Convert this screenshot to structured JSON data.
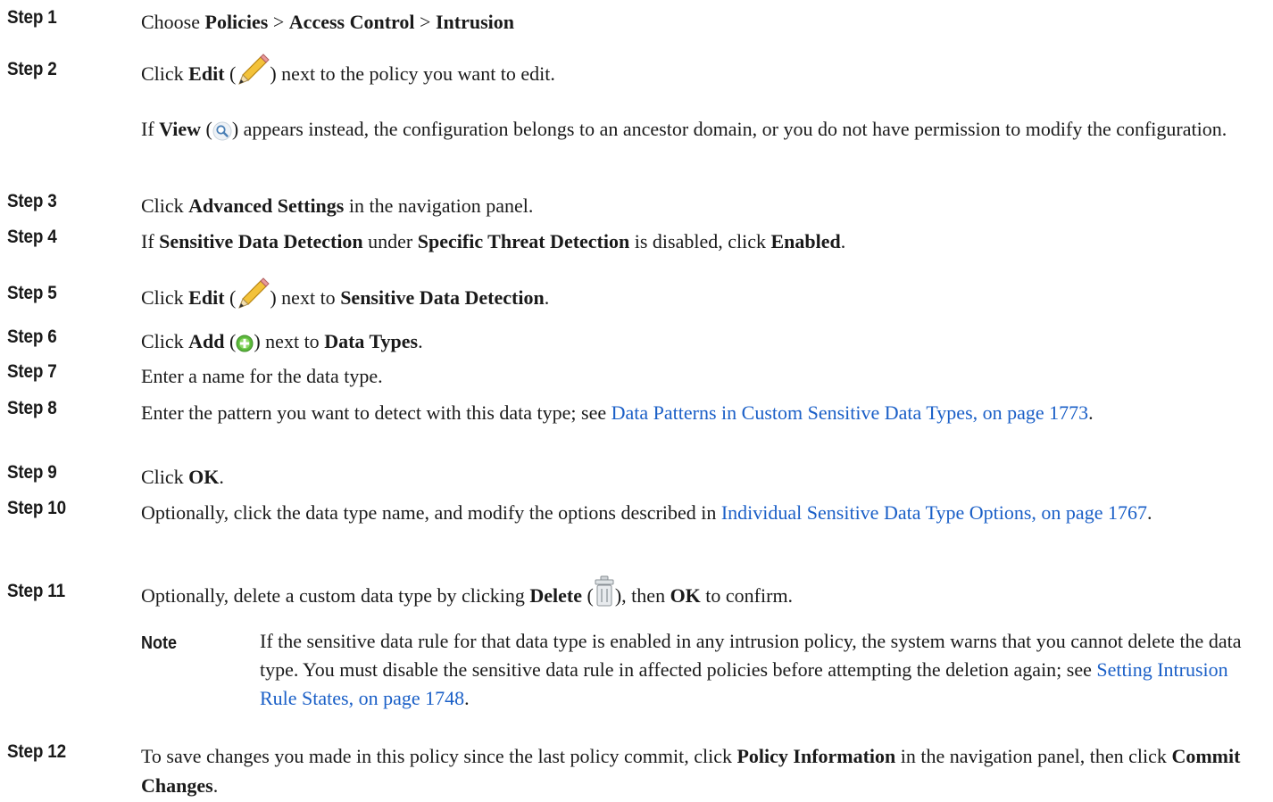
{
  "steps": [
    {
      "label": "Step 1",
      "t1": "Choose ",
      "b1": "Policies",
      "t2": " > ",
      "b2": "Access Control",
      "t3": " > ",
      "b3": "Intrusion"
    },
    {
      "label": "Step 2",
      "t1": "Click ",
      "b1": "Edit",
      "t2": " (",
      "icon": "pencil-icon",
      "t3": ") next to the policy you want to edit.",
      "sub_t1": "If ",
      "sub_b1": "View",
      "sub_t2": " (",
      "sub_icon": "magnifier-icon",
      "sub_t3": ") appears instead, the configuration belongs to an ancestor domain, or you do not have permission to modify the configuration."
    },
    {
      "label": "Step 3",
      "t1": "Click ",
      "b1": "Advanced Settings",
      "t2": " in the navigation panel."
    },
    {
      "label": "Step 4",
      "t1": "If ",
      "b1": "Sensitive Data Detection",
      "t2": " under ",
      "b2": "Specific Threat Detection",
      "t3": " is disabled, click ",
      "b3": "Enabled",
      "t4": "."
    },
    {
      "label": "Step 5",
      "t1": "Click ",
      "b1": "Edit",
      "t2": " (",
      "icon": "pencil-icon",
      "t3": ") next to ",
      "b2": "Sensitive Data Detection",
      "t4": "."
    },
    {
      "label": "Step 6",
      "t1": "Click ",
      "b1": "Add",
      "t2": " (",
      "icon": "add-circle-icon",
      "t3": ") next to ",
      "b2": "Data Types",
      "t4": "."
    },
    {
      "label": "Step 7",
      "t1": "Enter a name for the data type."
    },
    {
      "label": "Step 8",
      "t1": "Enter the pattern you want to detect with this data type; see ",
      "link": "Data Patterns in Custom Sensitive Data Types, on page 1773",
      "t2": "."
    },
    {
      "label": "Step 9",
      "t1": "Click ",
      "b1": "OK",
      "t2": "."
    },
    {
      "label": "Step 10",
      "t1": "Optionally, click the data type name, and modify the options described in ",
      "link": "Individual Sensitive Data Type Options, on page 1767",
      "t2": "."
    },
    {
      "label": "Step 11",
      "t1": "Optionally, delete a custom data type by clicking ",
      "b1": "Delete",
      "t2": " (",
      "icon": "trash-icon",
      "t3": "), then ",
      "b2": "OK",
      "t4": " to confirm.",
      "note_label": "Note",
      "note_t1": "If the sensitive data rule for that data type is enabled in any intrusion policy, the system warns that you cannot delete the data type. You must disable the sensitive data rule in affected policies before attempting the deletion again; see ",
      "note_link": "Setting Intrusion Rule States, on page 1748",
      "note_t2": "."
    },
    {
      "label": "Step 12",
      "t1": "To save changes you made in this policy since the last policy commit, click ",
      "b1": "Policy Information",
      "t2": " in the navigation panel, then click ",
      "b2": "Commit Changes",
      "t3": "."
    }
  ],
  "colors": {
    "link": "#1a5fc7",
    "text": "#1a1a1a"
  }
}
